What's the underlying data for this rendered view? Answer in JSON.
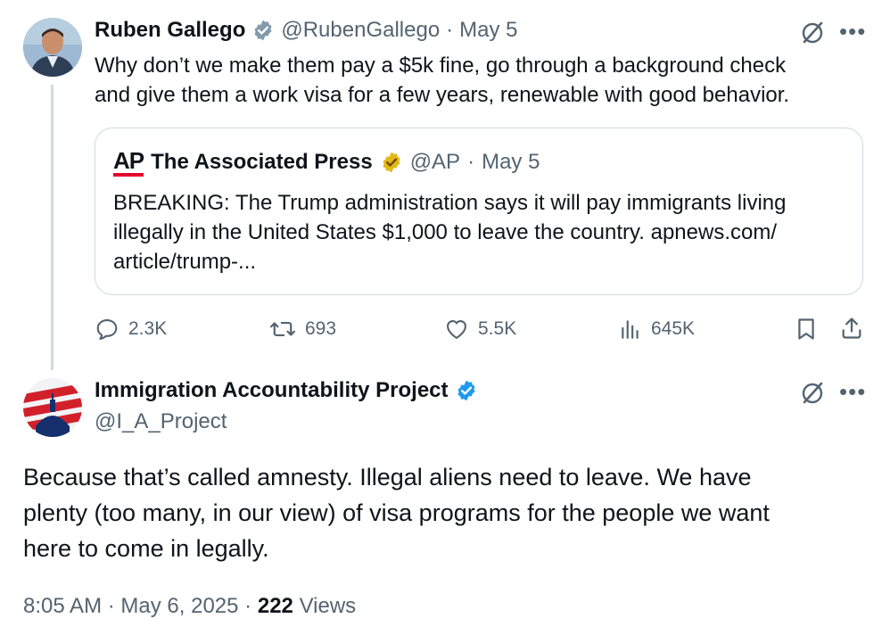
{
  "tweet1": {
    "author_name": "Ruben Gallego",
    "handle": "@RubenGallego",
    "separator": "·",
    "date": "May 5",
    "text_line1": "Why don’t we make them pay a $5k fine, go through a background check",
    "text_line2": "and give them a work visa for a few years, renewable with good behavior.",
    "quote": {
      "logo_text": "AP",
      "author_name": "The Associated Press",
      "handle": "@AP",
      "separator": "·",
      "date": "May 5",
      "text_line1": "BREAKING: The Trump administration says it will pay immigrants living",
      "text_line2": "illegally in the United States $1,000 to leave the country. apnews.com/",
      "text_line3": "article/trump-..."
    },
    "actions": {
      "replies": "2.3K",
      "reposts": "693",
      "likes": "5.5K",
      "views": "645K"
    }
  },
  "tweet2": {
    "author_name": "Immigration Accountability Project",
    "handle": "@I_A_Project",
    "text_line1": "Because that’s called amnesty. Illegal aliens need to leave. We have",
    "text_line2": "plenty (too many, in our view) of visa programs for the people we want",
    "text_line3": "here to come in legally.",
    "time": "8:05 AM",
    "separator1": "·",
    "date": "May 6, 2025",
    "separator2": "·",
    "views_count": "222",
    "views_label": "Views"
  },
  "colors": {
    "verified_blue": "#1d9bf0",
    "verified_gold": "#e2b719",
    "muted": "#536471",
    "ap_red": "#e4002b"
  },
  "icons": [
    "verified-badge-icon",
    "grok-icon",
    "more-icon",
    "reply-icon",
    "repost-icon",
    "like-icon",
    "views-icon",
    "bookmark-icon",
    "share-icon"
  ]
}
